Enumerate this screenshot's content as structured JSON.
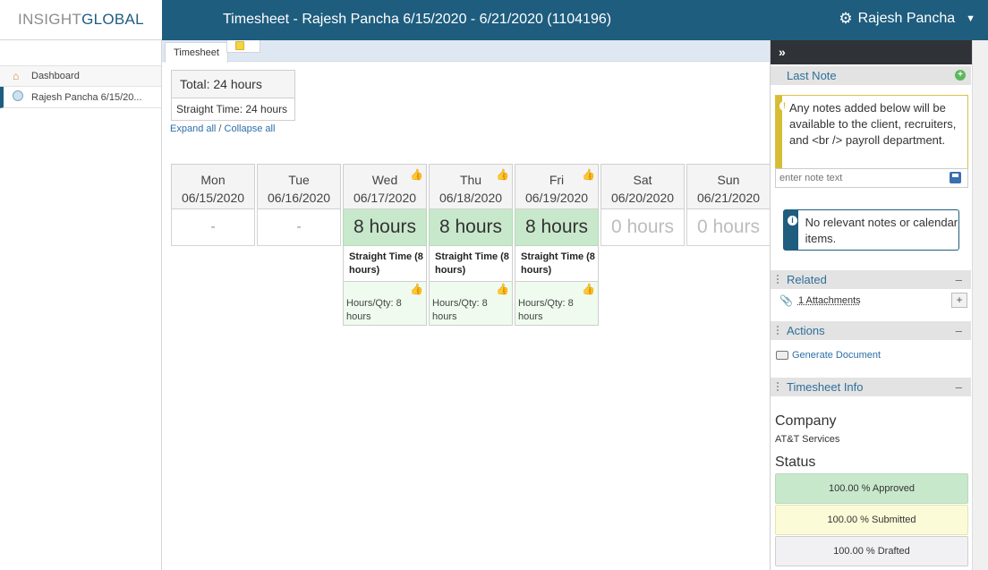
{
  "logo": {
    "part1": "INSIGHT",
    "part2": "GLOBAL"
  },
  "header": {
    "title": "Timesheet - Rajesh Pancha 6/15/2020 - 6/21/2020 (1104196)",
    "user": "Rajesh Pancha"
  },
  "sidebar": {
    "items": [
      {
        "label": "Dashboard",
        "icon": "home-icon"
      },
      {
        "label": "Rajesh Pancha 6/15/20...",
        "icon": "clock-icon"
      }
    ]
  },
  "tabs": [
    {
      "label": "Timesheet"
    },
    {
      "label": "",
      "icon": "sticky-note-icon"
    }
  ],
  "summary": {
    "total": "Total: 24 hours",
    "straight": "Straight Time: 24 hours",
    "expand": "Expand all",
    "sep": " / ",
    "collapse": "Collapse all"
  },
  "days": [
    {
      "dow": "Mon",
      "date": "06/15/2020",
      "hours": "-"
    },
    {
      "dow": "Tue",
      "date": "06/16/2020",
      "hours": "-"
    },
    {
      "dow": "Wed",
      "date": "06/17/2020",
      "hours": "8 hours",
      "entry": "Straight Time (8 hours)",
      "qty": "Hours/Qty: 8 hours"
    },
    {
      "dow": "Thu",
      "date": "06/18/2020",
      "hours": "8 hours",
      "entry": "Straight Time (8 hours)",
      "qty": "Hours/Qty: 8 hours"
    },
    {
      "dow": "Fri",
      "date": "06/19/2020",
      "hours": "8 hours",
      "entry": "Straight Time (8 hours)",
      "qty": "Hours/Qty: 8 hours"
    },
    {
      "dow": "Sat",
      "date": "06/20/2020",
      "hours": "0 hours"
    },
    {
      "dow": "Sun",
      "date": "06/21/2020",
      "hours": "0 hours"
    }
  ],
  "right": {
    "collapse": "»",
    "last_note": "Last Note",
    "notice": "Any notes added below will be available to the client, recruiters, and <br /> payroll department.",
    "note_placeholder": "enter note text",
    "no_notes": "No relevant notes or calendar items.",
    "related": "Related",
    "attachments": "1 Attachments",
    "actions": "Actions",
    "generate": "Generate Document",
    "info": "Timesheet Info",
    "company_label": "Company",
    "company": "AT&T Services",
    "status_label": "Status",
    "approved": "100.00 % Approved",
    "submitted": "100.00 % Submitted",
    "drafted": "100.00 % Drafted"
  }
}
